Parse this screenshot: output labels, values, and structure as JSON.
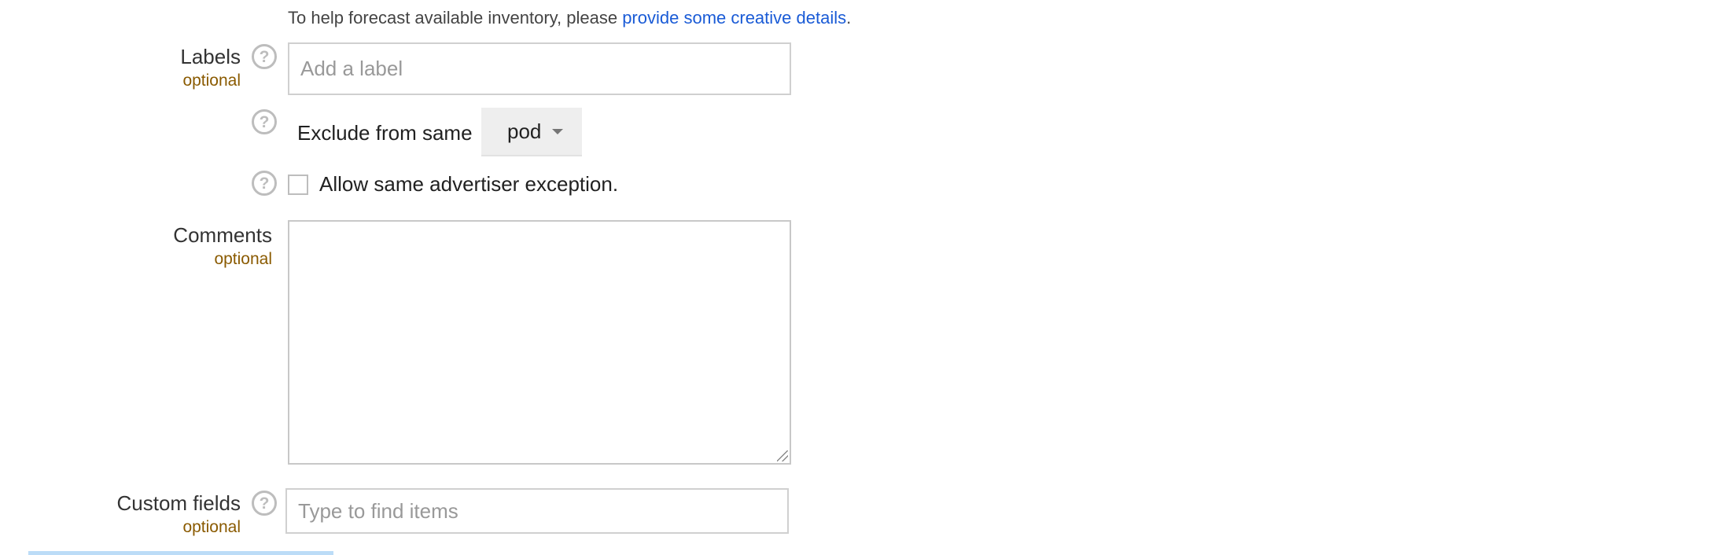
{
  "creative_hint": {
    "prefix": "To help forecast available inventory, please ",
    "link_text": "provide some creative details",
    "suffix": "."
  },
  "labels": {
    "label": "Labels",
    "optional": "optional",
    "placeholder": "Add a label"
  },
  "exclusion": {
    "label": "Exclude from same",
    "selected": "pod"
  },
  "advertiser_exception": {
    "label": "Allow same advertiser exception.",
    "checked": false
  },
  "comments": {
    "label": "Comments",
    "optional": "optional",
    "value": ""
  },
  "custom_fields": {
    "label": "Custom fields",
    "optional": "optional",
    "placeholder": "Type to find items"
  },
  "icons": {
    "help": "?"
  },
  "colors": {
    "link": "#1a5bd6",
    "optional": "#8a5a00",
    "help_icon": "#bdbdbd"
  }
}
